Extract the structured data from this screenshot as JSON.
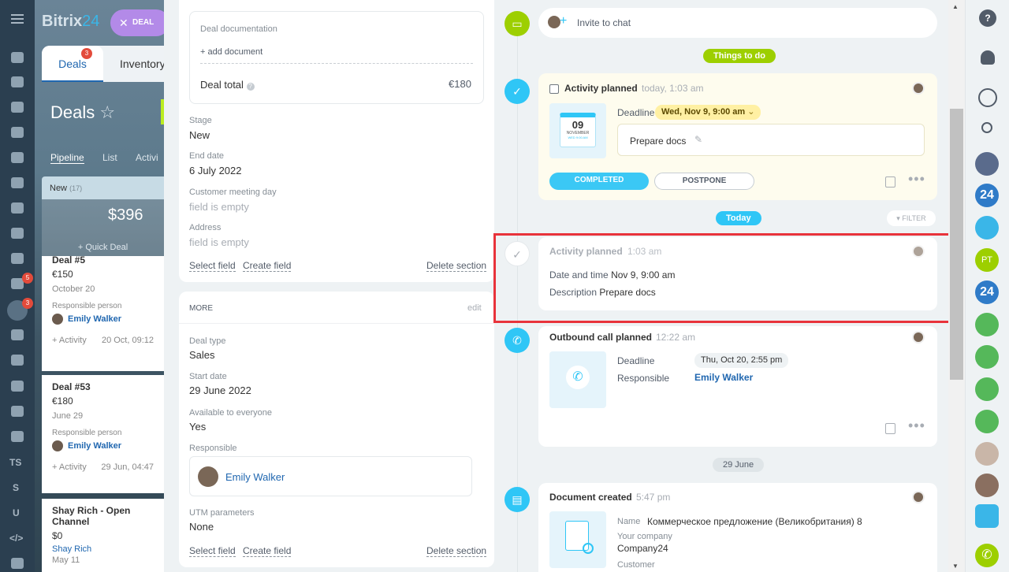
{
  "app": {
    "logo_name": "Bitrix",
    "logo_num": "24",
    "deal_button": "DEAL"
  },
  "crm": {
    "tabs": [
      {
        "label": "Deals",
        "badge": "3"
      },
      {
        "label": "Inventory"
      }
    ],
    "title": "Deals",
    "views": [
      "Pipeline",
      "List",
      "Activi"
    ],
    "column": {
      "name": "New",
      "count": "(17)",
      "sum": "$396",
      "quick": "+ Quick Deal"
    },
    "cards": [
      {
        "title": "Deal #5",
        "price": "€150",
        "date": "October 20",
        "resp_label": "Responsible person",
        "user": "Emily Walker",
        "activity": "+ Activity",
        "activity_date": "20 Oct, 09:12"
      },
      {
        "title": "Deal #53",
        "price": "€180",
        "date": "June 29",
        "resp_label": "Responsible person",
        "user": "Emily Walker",
        "activity": "+ Activity",
        "activity_date": "29 Jun, 04:47"
      },
      {
        "title": "Shay Rich - Open Channel",
        "price": "$0",
        "date": "May 11",
        "user": "Shay Rich"
      }
    ],
    "nav_badges": [
      "5",
      "3"
    ],
    "nav_texts": [
      "TS",
      "S",
      "U",
      "</>"
    ]
  },
  "details": {
    "doc_label": "Deal documentation",
    "add_doc": "+ add document",
    "total_label": "Deal total",
    "total_value": "€180",
    "stage_label": "Stage",
    "stage_value": "New",
    "end_label": "End date",
    "end_value": "6 July 2022",
    "meeting_label": "Customer meeting day",
    "meeting_value": "field is empty",
    "address_label": "Address",
    "address_value": "field is empty",
    "select_field": "Select field",
    "create_field": "Create field",
    "delete_section": "Delete section",
    "more_label": "MORE",
    "edit": "edit",
    "type_label": "Deal type",
    "type_value": "Sales",
    "start_label": "Start date",
    "start_value": "29 June 2022",
    "avail_label": "Available to everyone",
    "avail_value": "Yes",
    "resp_label": "Responsible",
    "resp_value": "Emily Walker",
    "utm_label": "UTM parameters",
    "utm_value": "None"
  },
  "timeline": {
    "invite": "Invite to chat",
    "todo_pill": "Things to do",
    "planned": {
      "title": "Activity planned",
      "time": "today, 1:03 am",
      "deadline_label": "Deadline",
      "deadline_value": "Wed, Nov 9, 9:00 am",
      "cal_day": "09",
      "cal_month": "NOVEMBER",
      "cal_sub": "WED 9:00 AM",
      "text": "Prepare docs",
      "completed": "COMPLETED",
      "postpone": "POSTPONE"
    },
    "today_pill": "Today",
    "filter": "FILTER",
    "done": {
      "title": "Activity planned",
      "time": "1:03 am",
      "date_label": "Date and time",
      "date_value": "Nov 9, 9:00 am",
      "desc_label": "Description",
      "desc_value": "Prepare docs"
    },
    "call": {
      "title": "Outbound call planned",
      "time": "12:22 am",
      "deadline_label": "Deadline",
      "deadline_value": "Thu, Oct 20, 2:55 pm",
      "resp_label": "Responsible",
      "resp_value": "Emily Walker"
    },
    "june_pill": "29 June",
    "doc": {
      "title": "Document created",
      "time": "5:47 pm",
      "name_label": "Name",
      "name_value": "Коммерческое предложение (Великобритания) 8",
      "company_label": "Your company",
      "company_value": "Company24",
      "customer_label": "Customer"
    }
  },
  "rightbar": {
    "help": "?",
    "badge24": "24",
    "pt": "PT"
  }
}
